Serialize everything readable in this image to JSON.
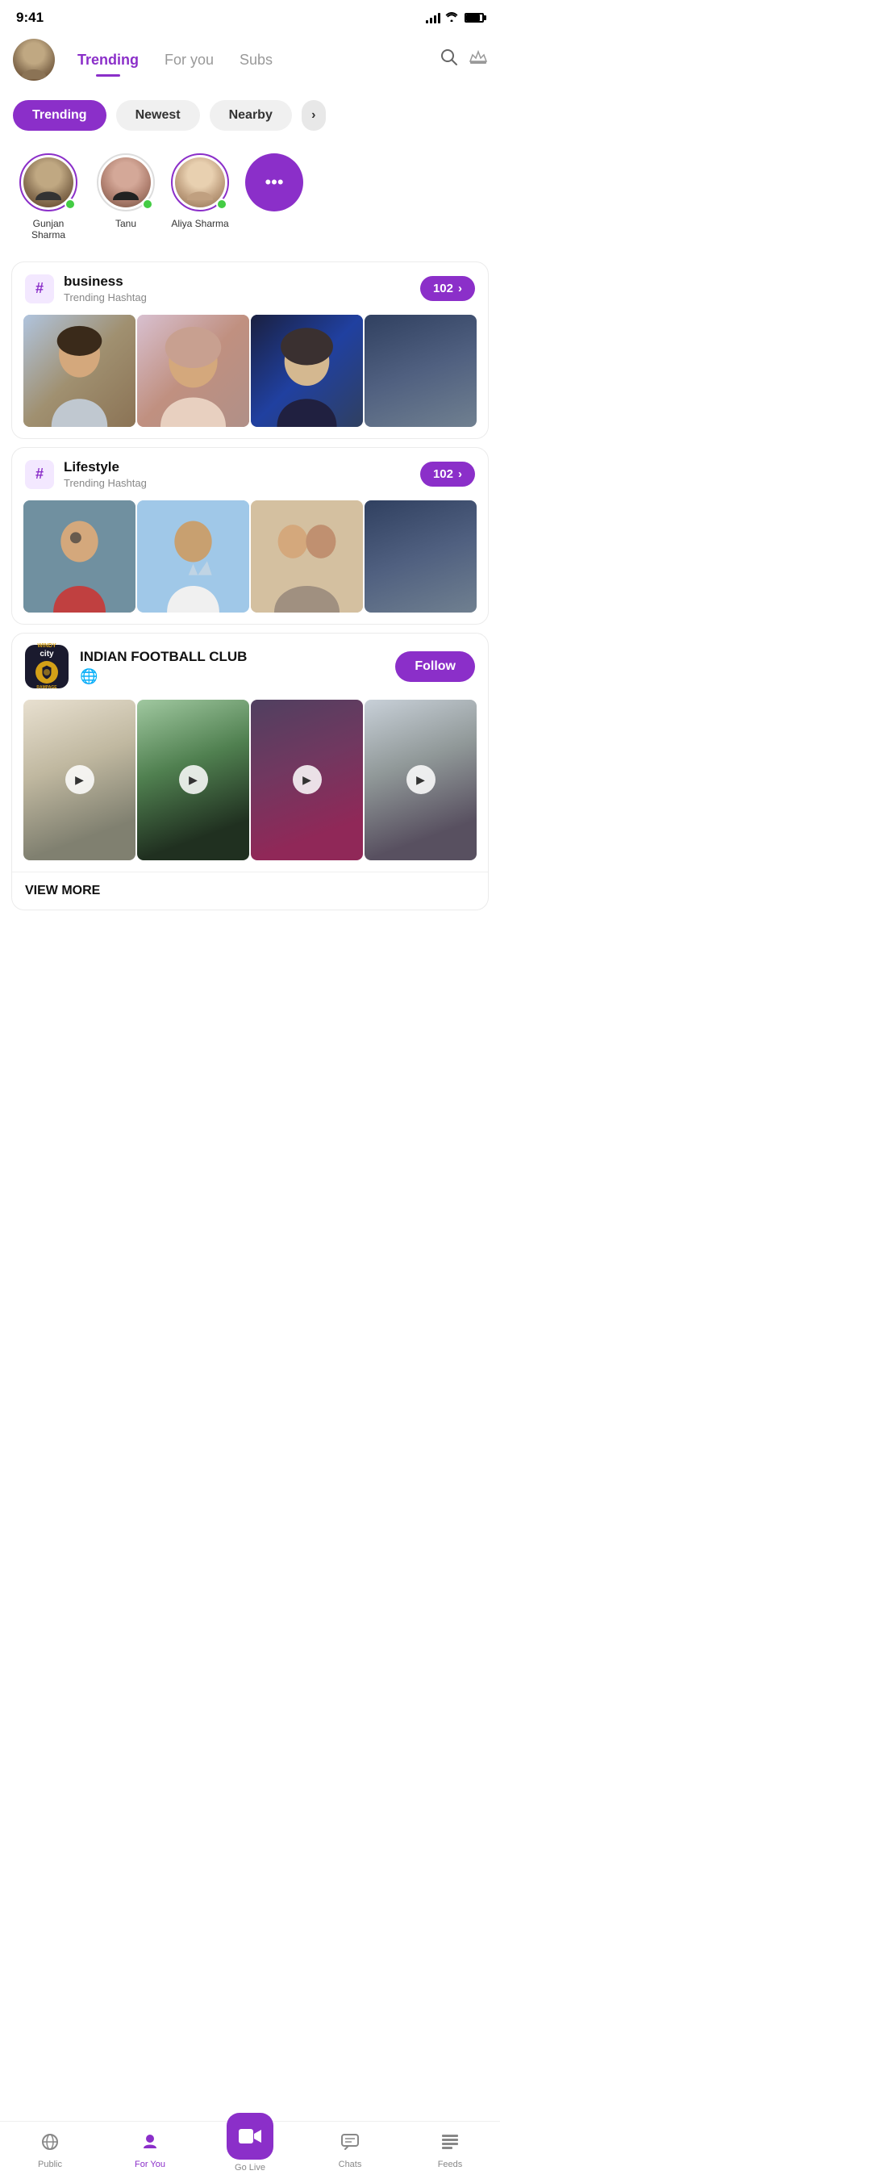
{
  "statusBar": {
    "time": "9:41",
    "signalBars": [
      4,
      7,
      10,
      13
    ],
    "wifi": "wifi",
    "battery": 85
  },
  "header": {
    "activeTab": "Trending",
    "tabs": [
      {
        "id": "trending",
        "label": "Trending",
        "active": true
      },
      {
        "id": "for-you",
        "label": "For you",
        "active": false
      },
      {
        "id": "subs",
        "label": "Subs",
        "active": false
      }
    ],
    "searchIcon": "🔍",
    "crownIcon": "👑"
  },
  "filters": {
    "pills": [
      {
        "label": "Trending",
        "active": true
      },
      {
        "label": "Newest",
        "active": false
      },
      {
        "label": "Nearby",
        "active": false
      }
    ]
  },
  "stories": {
    "items": [
      {
        "name": "Gunjan Sharma",
        "hasRing": true,
        "online": true
      },
      {
        "name": "Tanu",
        "hasRing": false,
        "online": true
      },
      {
        "name": "Aliya Sharma",
        "hasRing": true,
        "online": true
      }
    ],
    "moreBtn": "•••"
  },
  "hashtags": [
    {
      "name": "business",
      "subLabel": "Trending Hashtag",
      "count": "102",
      "images": [
        "img-woman-beanie",
        "img-woman-hijab",
        "img-woman-hijab2",
        "img-partial"
      ]
    },
    {
      "name": "Lifestyle",
      "subLabel": "Trending Hashtag",
      "count": "102",
      "images": [
        "img-man-sunglasses",
        "img-man-white-tank",
        "img-women-group",
        "img-partial"
      ]
    }
  ],
  "club": {
    "logoLine1": "WINDY",
    "logoLine2": "city",
    "logoLine3": "RAMPAGE",
    "name": "INDIAN FOOTBALL CLUB",
    "globeIcon": "🌐",
    "followLabel": "Follow",
    "videos": [
      "vid1",
      "vid2",
      "vid3",
      "vid4"
    ],
    "viewMore": "VIEW MORE"
  },
  "bottomNav": {
    "items": [
      {
        "id": "public",
        "label": "Public",
        "icon": "📡"
      },
      {
        "id": "for-you",
        "label": "For You",
        "icon": "👤",
        "active": true
      },
      {
        "id": "go-live",
        "label": "Go Live",
        "icon": "🎥",
        "isCenter": true
      },
      {
        "id": "chats",
        "label": "Chats",
        "icon": "💬"
      },
      {
        "id": "feeds",
        "label": "Feeds",
        "icon": "☰"
      }
    ]
  }
}
